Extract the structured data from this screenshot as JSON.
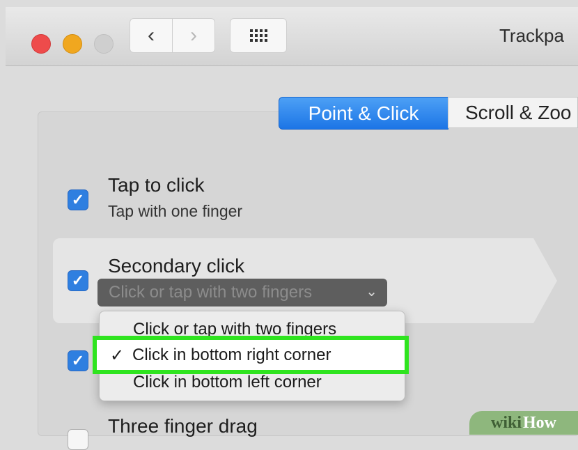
{
  "window": {
    "title": "Trackpa"
  },
  "toolbar": {
    "back_glyph": "‹",
    "forward_glyph": "›",
    "grid_icon": "grid-icon"
  },
  "tabs": [
    {
      "label": "Point & Click",
      "active": true
    },
    {
      "label": "Scroll & Zoo",
      "active": false
    }
  ],
  "options": [
    {
      "title": "Tap to click",
      "subtitle": "Tap with one finger",
      "checked": true
    },
    {
      "title": "Secondary click",
      "popup_value": "Click or tap with two fingers",
      "checked": true
    },
    {
      "title": "",
      "checked": true
    },
    {
      "title": "Three finger drag",
      "checked": false
    }
  ],
  "menu": {
    "items": [
      {
        "label": "Click or tap with two fingers",
        "selected": false
      },
      {
        "label": "Click in bottom right corner",
        "selected": true
      },
      {
        "label": "Click in bottom left corner",
        "selected": false
      }
    ],
    "check_glyph": "✓"
  },
  "checkbox_glyph": "✓",
  "watermark": {
    "prefix": "wiki",
    "suffix": "How"
  },
  "colors": {
    "accent": "#1c75e6",
    "highlight": "#2fe41f"
  }
}
